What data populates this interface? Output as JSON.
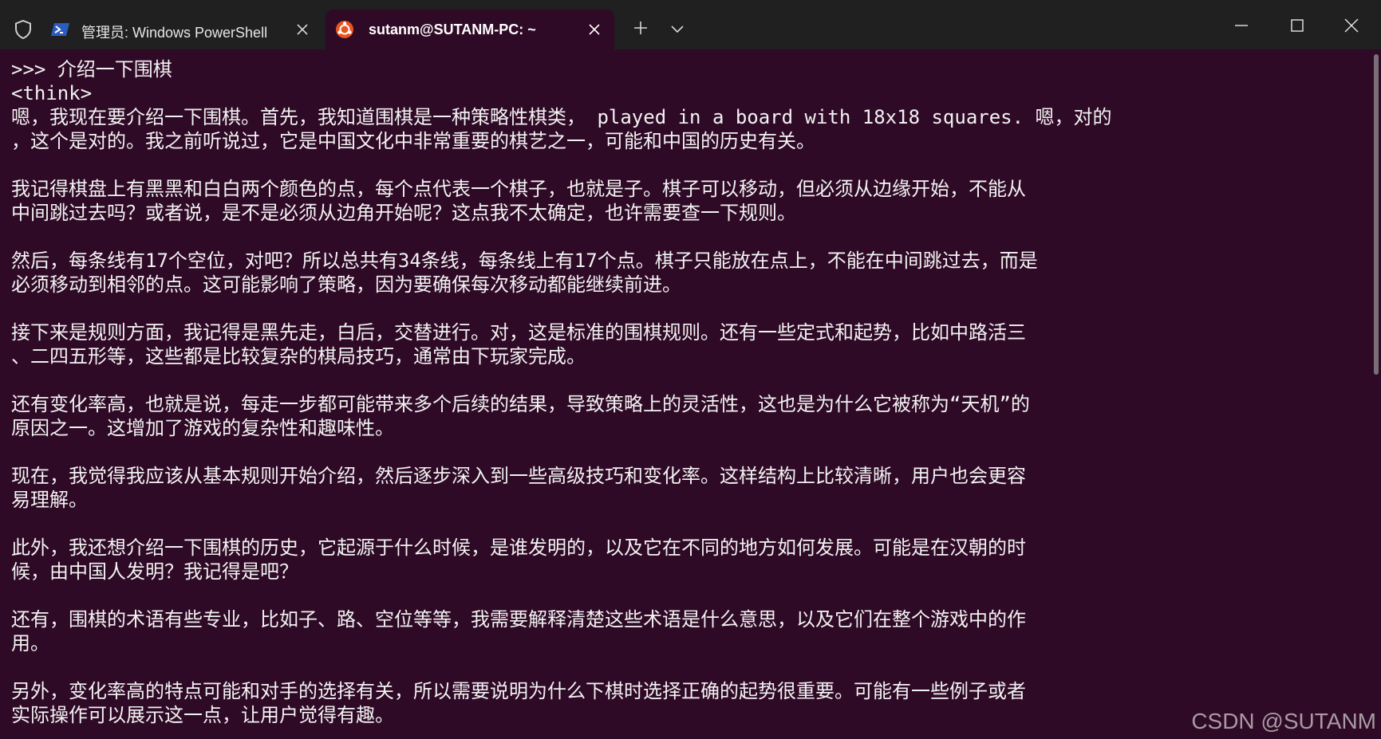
{
  "tabs": [
    {
      "title": "管理员: Windows PowerShell",
      "active": false,
      "icon": "powershell-icon"
    },
    {
      "title": "sutanm@SUTANM-PC: ~",
      "active": true,
      "icon": "ubuntu-icon"
    }
  ],
  "colors": {
    "titlebar_bg": "#202020",
    "terminal_bg": "#2f0a26",
    "text": "#f2f2f2",
    "powershell_blue": "#2b5cbf",
    "ubuntu_orange": "#e95420"
  },
  "terminal": {
    "lines": [
      ">>> 介绍一下围棋",
      "<think>",
      "嗯，我现在要介绍一下围棋。首先，我知道围棋是一种策略性棋类， played in a board with 18x18 squares. 嗯，对的",
      "，这个是对的。我之前听说过，它是中国文化中非常重要的棋艺之一，可能和中国的历史有关。",
      "",
      "我记得棋盘上有黑黑和白白两个颜色的点，每个点代表一个棋子，也就是子。棋子可以移动，但必须从边缘开始，不能从",
      "中间跳过去吗？或者说，是不是必须从边角开始呢？这点我不太确定，也许需要查一下规则。",
      "",
      "然后，每条线有17个空位，对吧？所以总共有34条线，每条线上有17个点。棋子只能放在点上，不能在中间跳过去，而是",
      "必须移动到相邻的点。这可能影响了策略，因为要确保每次移动都能继续前进。",
      "",
      "接下来是规则方面，我记得是黑先走，白后，交替进行。对，这是标准的围棋规则。还有一些定式和起势，比如中路活三",
      "、二四五形等，这些都是比较复杂的棋局技巧，通常由下玩家完成。",
      "",
      "还有变化率高，也就是说，每走一步都可能带来多个后续的结果，导致策略上的灵活性，这也是为什么它被称为“天机”的",
      "原因之一。这增加了游戏的复杂性和趣味性。",
      "",
      "现在，我觉得我应该从基本规则开始介绍，然后逐步深入到一些高级技巧和变化率。这样结构上比较清晰，用户也会更容",
      "易理解。",
      "",
      "此外，我还想介绍一下围棋的历史，它起源于什么时候，是谁发明的，以及它在不同的地方如何发展。可能是在汉朝的时",
      "候，由中国人发明？我记得是吧？",
      "",
      "还有，围棋的术语有些专业，比如子、路、空位等等，我需要解释清楚这些术语是什么意思，以及它们在整个游戏中的作",
      "用。",
      "",
      "另外，变化率高的特点可能和对手的选择有关，所以需要说明为什么下棋时选择正确的起势很重要。可能有一些例子或者",
      "实际操作可以展示这一点，让用户觉得有趣。"
    ]
  },
  "watermark": "CSDN @SUTANM"
}
